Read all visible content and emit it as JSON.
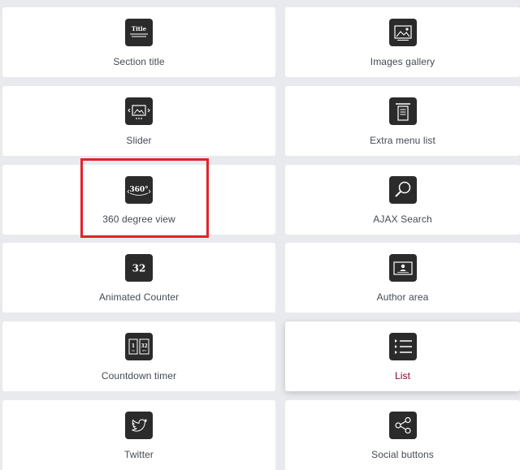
{
  "widgets": [
    {
      "label": "Section title",
      "icon": "section-title-icon",
      "icon_text": "Title"
    },
    {
      "label": "Images gallery",
      "icon": "image-gallery-icon"
    },
    {
      "label": "Slider",
      "icon": "slider-icon"
    },
    {
      "label": "Extra menu list",
      "icon": "extra-menu-list-icon"
    },
    {
      "label": "360 degree view",
      "icon": "360-view-icon",
      "icon_text": "360°"
    },
    {
      "label": "AJAX Search",
      "icon": "search-icon"
    },
    {
      "label": "Animated Counter",
      "icon": "counter-icon",
      "icon_text": "32"
    },
    {
      "label": "Author area",
      "icon": "author-card-icon"
    },
    {
      "label": "Countdown timer",
      "icon": "countdown-icon",
      "icon_text_a": "1",
      "icon_text_b": "32",
      "icon_sub_a": "DS",
      "icon_sub_b": "MTS"
    },
    {
      "label": "List",
      "icon": "list-icon"
    },
    {
      "label": "Twitter",
      "icon": "twitter-icon"
    },
    {
      "label": "Social buttons",
      "icon": "share-icon"
    }
  ],
  "colors": {
    "background": "#e9eaed",
    "card": "#ffffff",
    "icon_bg": "#2b2b2b",
    "label": "#444b55",
    "active_label": "#93003c",
    "highlight": "#e3232a"
  }
}
